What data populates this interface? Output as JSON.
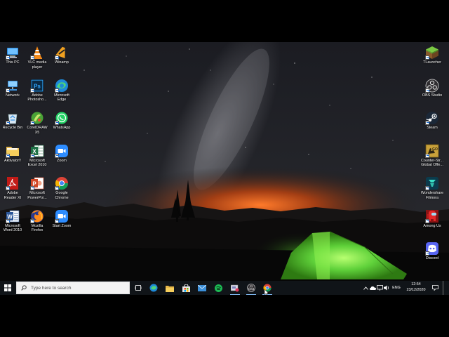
{
  "desktop": {
    "left_icons": [
      {
        "label": "This PC",
        "icon": "this-pc-icon"
      },
      {
        "label": "VLC media\nplayer",
        "icon": "vlc-icon"
      },
      {
        "label": "Winamp",
        "icon": "winamp-icon"
      },
      {
        "label": "Network",
        "icon": "network-icon"
      },
      {
        "label": "Adobe\nPhotosho...",
        "icon": "photoshop-icon"
      },
      {
        "label": "Microsoft\nEdge",
        "icon": "edge-icon"
      },
      {
        "label": "Recycle Bin",
        "icon": "recycle-bin-icon"
      },
      {
        "label": "CorelDRAW\nX5",
        "icon": "coreldraw-icon"
      },
      {
        "label": "WhatsApp",
        "icon": "whatsapp-icon"
      },
      {
        "label": "Aktivator!!",
        "icon": "folder-icon"
      },
      {
        "label": "Microsoft\nExcel 2010",
        "icon": "excel-icon"
      },
      {
        "label": "Zoom",
        "icon": "zoom-icon"
      },
      {
        "label": "Adobe\nReader XI",
        "icon": "adobe-reader-icon"
      },
      {
        "label": "Microsoft\nPowerPoi...",
        "icon": "powerpoint-icon"
      },
      {
        "label": "Google\nChrome",
        "icon": "chrome-icon"
      },
      {
        "label": "Microsoft\nWord 2010",
        "icon": "word-icon"
      },
      {
        "label": "Mozilla\nFirefox",
        "icon": "firefox-icon"
      },
      {
        "label": "Start Zoom",
        "icon": "start-zoom-icon"
      }
    ],
    "right_icons": [
      {
        "label": "TLauncher",
        "icon": "tlauncher-icon"
      },
      {
        "label": "OBS Studio",
        "icon": "obs-icon"
      },
      {
        "label": "Steam",
        "icon": "steam-icon"
      },
      {
        "label": "Counter-Str...\nGlobal Offe...",
        "icon": "csgo-icon"
      },
      {
        "label": "Wondershare\nFilmora",
        "icon": "filmora-icon"
      },
      {
        "label": "Among Us",
        "icon": "among-us-icon"
      },
      {
        "label": "Discord",
        "icon": "discord-icon"
      }
    ]
  },
  "taskbar": {
    "search_placeholder": "Type here to search",
    "pinned": [
      "task-view-icon",
      "edge-icon",
      "file-explorer-icon",
      "store-icon",
      "mail-icon",
      "spotify-icon",
      "snipping-icon",
      "obs-icon",
      "chrome-icon"
    ],
    "tray": {
      "language": "ENG",
      "time": "12:54",
      "date": "23/12/2020"
    }
  },
  "colors": {
    "taskbar_bg": "#101418",
    "tent_green": "#5fd13a",
    "sky_glow": "#d9581c",
    "accent": "#7fb8f0"
  }
}
